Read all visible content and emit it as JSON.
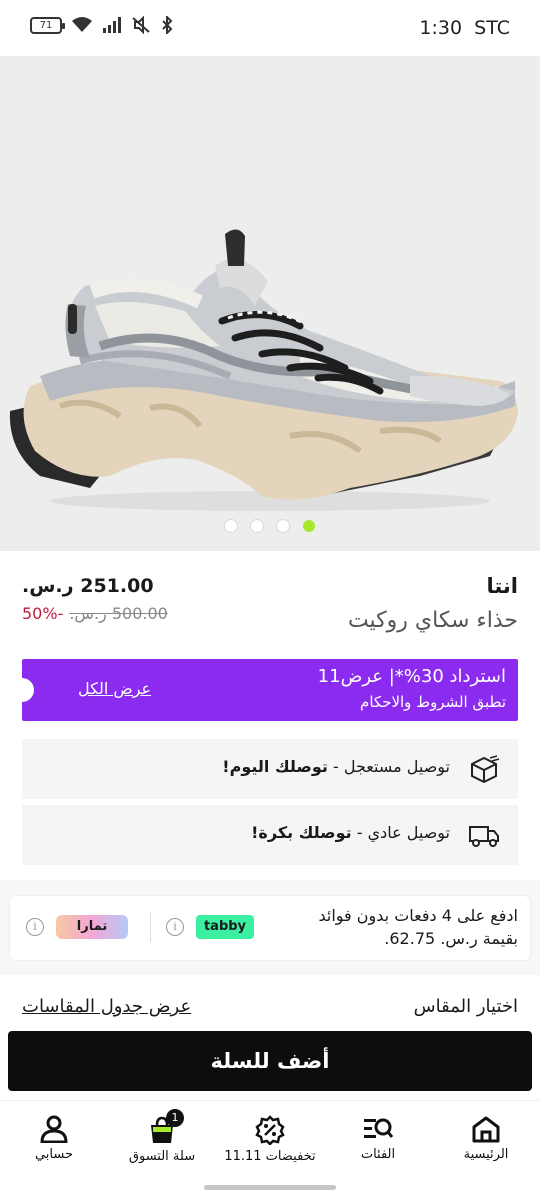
{
  "status_bar": {
    "time": "1:30",
    "carrier": "STC",
    "battery": "71"
  },
  "hero": {
    "slides": 4,
    "active_index": 3
  },
  "product": {
    "brand": "انتا",
    "name": "حذاء سكاي روكيت",
    "price": "251.00 ر.س.",
    "old_price": "500.00 ر.س.",
    "discount": "50%-"
  },
  "promo": {
    "title": "استرداد 30%*| عرض11",
    "subtitle": "تطبق الشروط والاحكام",
    "link": "عرض الكل",
    "color": "#8c2bf0"
  },
  "delivery": [
    {
      "prefix": "توصيل مستعجل - ",
      "bold": "توصلك اليوم!",
      "icon": "express-box-icon"
    },
    {
      "prefix": "توصيل عادي - ",
      "bold": "توصلك بكرة!",
      "icon": "truck-icon"
    }
  ],
  "installment": {
    "line1": "ادفع على 4 دفعات بدون فوائد",
    "line2": "بقيمة ر.س. 62.75.",
    "tabby_label": "tabby",
    "tamara_label": "تمارا"
  },
  "size": {
    "label": "اختيار المقاس",
    "chart_link": "عرض جدول المقاسات"
  },
  "add_to_cart": "أضف للسلة",
  "nav": {
    "home": "الرئيسية",
    "categories": "الفئات",
    "deals": "تخفيضات 11.11",
    "cart": "سلة التسوق",
    "cart_count": "1",
    "account": "حسابي"
  },
  "colors": {
    "accent_green": "#a5e82c",
    "discount_red": "#c4183c",
    "tabby_green": "#3bf0a0"
  }
}
